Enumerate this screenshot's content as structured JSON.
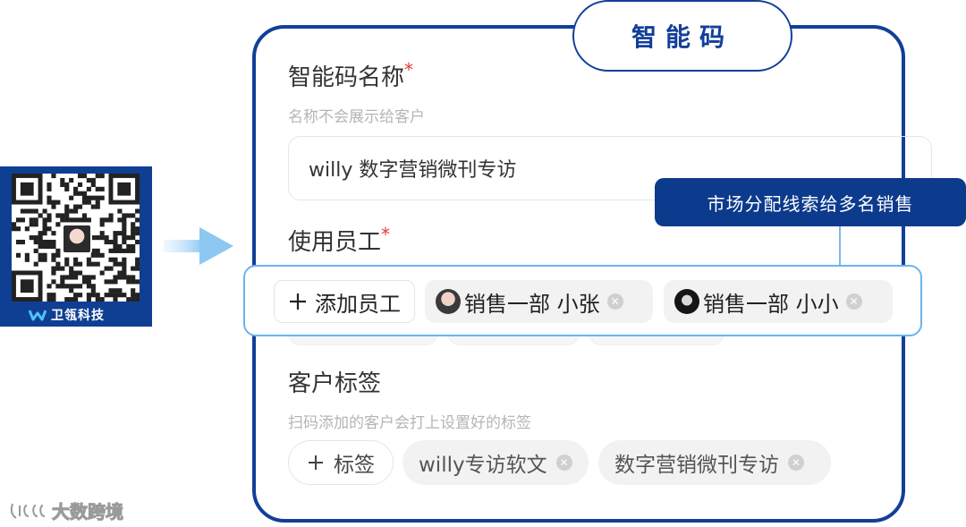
{
  "qr": {
    "brand": "卫瓴科技",
    "icon": "brand-logo-icon"
  },
  "panel": {
    "title": "智能码"
  },
  "name_field": {
    "label": "智能码名称",
    "required_mark": "*",
    "hint": "名称不会展示给客户",
    "value": "willy 数字营销微刊专访"
  },
  "callout": {
    "text": "市场分配线索给多名销售"
  },
  "employees": {
    "label": "使用员工",
    "required_mark": "*",
    "add_label": "添加员工",
    "items": [
      {
        "name": "销售一部 小张"
      },
      {
        "name": "销售一部 小小"
      }
    ]
  },
  "tags": {
    "label": "客户标签",
    "hint": "扫码添加的客户会打上设置好的标签",
    "add_label": "标签",
    "items": [
      {
        "name": "willy专访软文"
      },
      {
        "name": "数字营销微刊专访"
      }
    ]
  },
  "watermark": {
    "text": "大数跨境"
  },
  "colors": {
    "primary": "#123f98",
    "highlight": "#6ab4ee",
    "required": "#e53935"
  }
}
